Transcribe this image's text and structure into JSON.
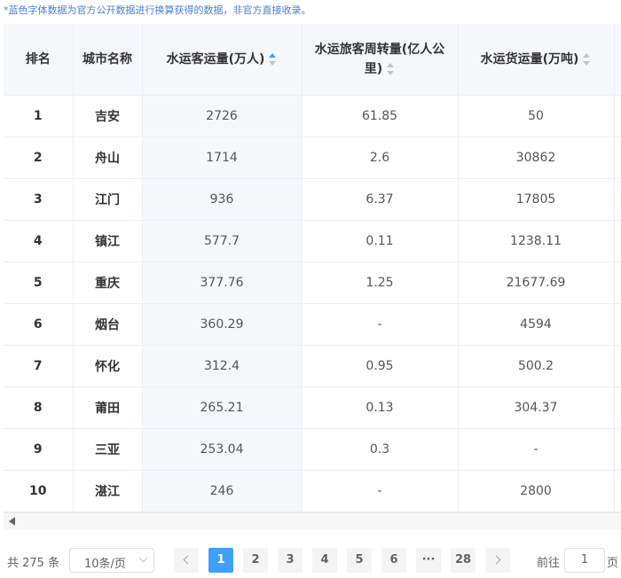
{
  "note": "*蓝色字体数据为官方公开数据进行换算获得的数据，非官方直接收录。",
  "table": {
    "headers": {
      "rank": "排名",
      "city": "城市名称",
      "passengers": "水运客运量(万人)",
      "turnover_line1": "水运旅客周转量(亿人公",
      "turnover_line2": "里)",
      "cargo": "水运货运量(万吨)"
    },
    "sorted_column": "passengers",
    "rows": [
      {
        "rank": "1",
        "city": "吉安",
        "passengers": "2726",
        "turnover": "61.85",
        "cargo": "50"
      },
      {
        "rank": "2",
        "city": "舟山",
        "passengers": "1714",
        "turnover": "2.6",
        "cargo": "30862"
      },
      {
        "rank": "3",
        "city": "江门",
        "passengers": "936",
        "turnover": "6.37",
        "cargo": "17805"
      },
      {
        "rank": "4",
        "city": "镇江",
        "passengers": "577.7",
        "turnover": "0.11",
        "cargo": "1238.11"
      },
      {
        "rank": "5",
        "city": "重庆",
        "passengers": "377.76",
        "turnover": "1.25",
        "cargo": "21677.69"
      },
      {
        "rank": "6",
        "city": "烟台",
        "passengers": "360.29",
        "turnover": "-",
        "cargo": "4594"
      },
      {
        "rank": "7",
        "city": "怀化",
        "passengers": "312.4",
        "turnover": "0.95",
        "cargo": "500.2"
      },
      {
        "rank": "8",
        "city": "莆田",
        "passengers": "265.21",
        "turnover": "0.13",
        "cargo": "304.37"
      },
      {
        "rank": "9",
        "city": "三亚",
        "passengers": "253.04",
        "turnover": "0.3",
        "cargo": "-"
      },
      {
        "rank": "10",
        "city": "湛江",
        "passengers": "246",
        "turnover": "-",
        "cargo": "2800"
      }
    ]
  },
  "pagination": {
    "total": "共 275 条",
    "page_size": "10条/页",
    "pages": [
      "1",
      "2",
      "3",
      "4",
      "5",
      "6"
    ],
    "ellipsis": "···",
    "last_page": "28",
    "current_page": "1",
    "goto_prefix": "前往",
    "goto_value": "1",
    "goto_suffix": "页"
  },
  "colors": {
    "accent": "#409eff",
    "note_text": "#4a7fd6",
    "header_bg": "#f5f7fa",
    "border": "#ebeef5"
  }
}
